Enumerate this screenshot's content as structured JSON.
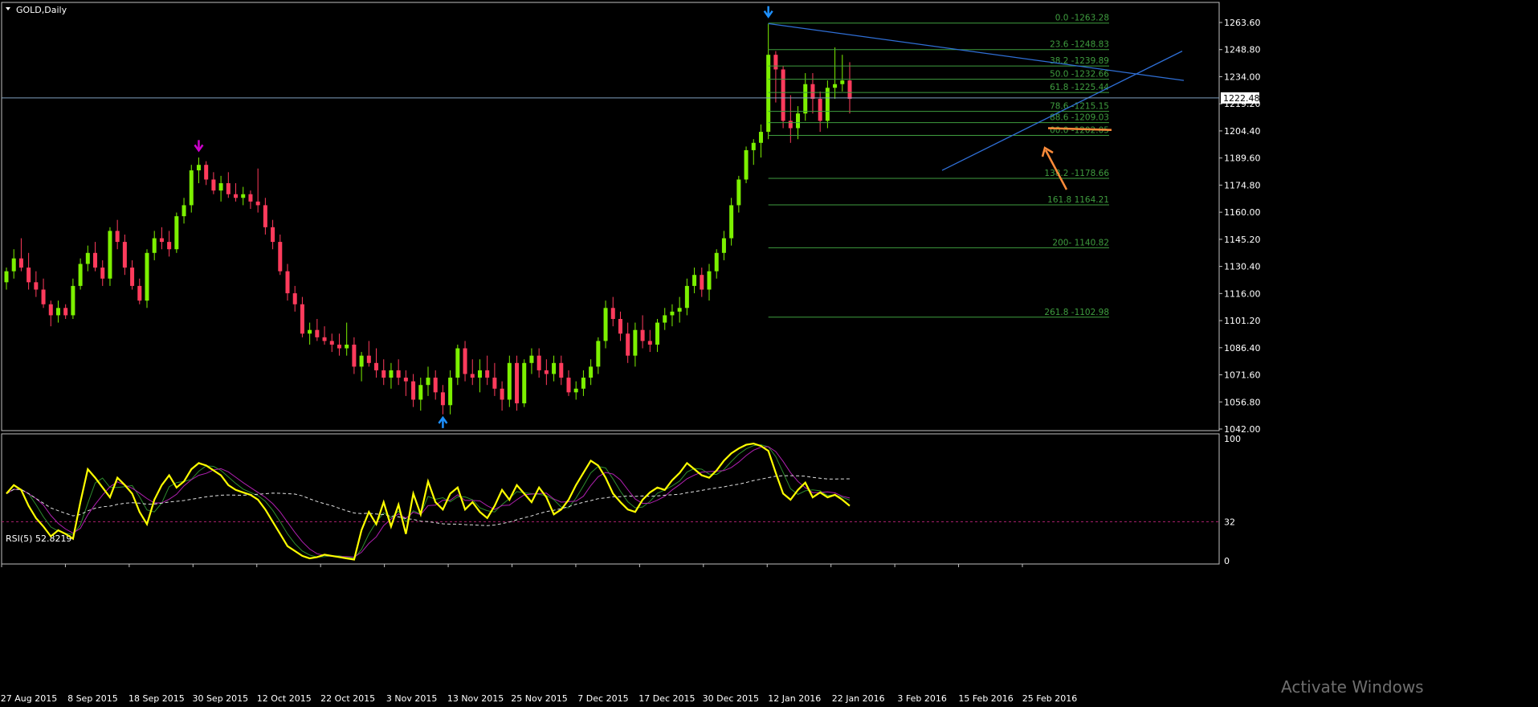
{
  "watermark": "Activate Windows",
  "colors": {
    "background": "#000000",
    "grid_border": "#c0c0c0",
    "candle_up": "#7cf000",
    "candle_down": "#ff3b5c",
    "fibo": "#3f9d3f",
    "fibo_text": "#3f9d3f",
    "trendline": "#2f6fd6",
    "price_line": "#7fa0c0",
    "arrow_orange": "#ff8c3a",
    "rsi_main": "#ffff00",
    "rsi_ma1": "#2e8b2e",
    "rsi_ma2": "#b020b0",
    "rsi_trend": "#e0e0e0",
    "rsi_level": "#b02070",
    "fractal_up": "#1e90ff",
    "fractal_down": "#cc00cc"
  },
  "chart_data": [
    {
      "type": "candlestick",
      "title": "GOLD,Daily",
      "ylim": [
        1042.0,
        1270.0
      ],
      "y_ticks": [
        "1263.60",
        "1248.80",
        "1234.00",
        "1219.20",
        "1204.40",
        "1189.60",
        "1174.80",
        "1160.00",
        "1145.20",
        "1130.40",
        "1116.00",
        "1101.20",
        "1086.40",
        "1071.60",
        "1056.80",
        "1042.00"
      ],
      "current_price": "1222.48",
      "x_tick_labels": [
        "27 Aug 2015",
        "8 Sep 2015",
        "18 Sep 2015",
        "30 Sep 2015",
        "12 Oct 2015",
        "22 Oct 2015",
        "3 Nov 2015",
        "13 Nov 2015",
        "25 Nov 2015",
        "7 Dec 2015",
        "17 Dec 2015",
        "30 Dec 2015",
        "12 Jan 2016",
        "22 Jan 2016",
        "3 Feb 2016",
        "15 Feb 2016",
        "25 Feb 2016"
      ],
      "ohlc": [
        [
          1122,
          1130,
          1118,
          1128
        ],
        [
          1128,
          1140,
          1124,
          1135
        ],
        [
          1135,
          1146,
          1128,
          1130
        ],
        [
          1130,
          1138,
          1118,
          1122
        ],
        [
          1122,
          1128,
          1114,
          1118
        ],
        [
          1118,
          1124,
          1108,
          1110
        ],
        [
          1110,
          1112,
          1098,
          1104
        ],
        [
          1104,
          1112,
          1100,
          1108
        ],
        [
          1108,
          1110,
          1102,
          1104
        ],
        [
          1104,
          1124,
          1102,
          1120
        ],
        [
          1120,
          1135,
          1118,
          1132
        ],
        [
          1132,
          1142,
          1128,
          1138
        ],
        [
          1138,
          1144,
          1128,
          1130
        ],
        [
          1130,
          1134,
          1120,
          1124
        ],
        [
          1124,
          1152,
          1120,
          1150
        ],
        [
          1150,
          1156,
          1140,
          1144
        ],
        [
          1144,
          1148,
          1126,
          1130
        ],
        [
          1130,
          1134,
          1118,
          1120
        ],
        [
          1120,
          1124,
          1110,
          1112
        ],
        [
          1112,
          1140,
          1108,
          1138
        ],
        [
          1138,
          1150,
          1134,
          1146
        ],
        [
          1146,
          1152,
          1140,
          1144
        ],
        [
          1144,
          1150,
          1136,
          1140
        ],
        [
          1140,
          1160,
          1138,
          1158
        ],
        [
          1158,
          1168,
          1154,
          1164
        ],
        [
          1164,
          1186,
          1160,
          1183
        ],
        [
          1183,
          1190,
          1176,
          1186
        ],
        [
          1186,
          1188,
          1175,
          1178
        ],
        [
          1178,
          1182,
          1170,
          1172
        ],
        [
          1172,
          1180,
          1166,
          1176
        ],
        [
          1176,
          1182,
          1168,
          1170
        ],
        [
          1170,
          1176,
          1166,
          1168
        ],
        [
          1168,
          1174,
          1164,
          1170
        ],
        [
          1170,
          1172,
          1162,
          1166
        ],
        [
          1166,
          1184,
          1160,
          1164
        ],
        [
          1164,
          1168,
          1148,
          1152
        ],
        [
          1152,
          1156,
          1140,
          1144
        ],
        [
          1144,
          1148,
          1126,
          1128
        ],
        [
          1128,
          1132,
          1112,
          1116
        ],
        [
          1116,
          1120,
          1106,
          1110
        ],
        [
          1110,
          1114,
          1092,
          1094
        ],
        [
          1094,
          1100,
          1088,
          1096
        ],
        [
          1096,
          1102,
          1090,
          1092
        ],
        [
          1092,
          1098,
          1088,
          1090
        ],
        [
          1090,
          1094,
          1084,
          1088
        ],
        [
          1088,
          1094,
          1082,
          1086
        ],
        [
          1086,
          1100,
          1082,
          1088
        ],
        [
          1088,
          1092,
          1072,
          1076
        ],
        [
          1076,
          1084,
          1068,
          1082
        ],
        [
          1082,
          1090,
          1076,
          1078
        ],
        [
          1078,
          1086,
          1070,
          1074
        ],
        [
          1074,
          1080,
          1066,
          1070
        ],
        [
          1070,
          1078,
          1064,
          1074
        ],
        [
          1074,
          1080,
          1066,
          1070
        ],
        [
          1070,
          1074,
          1060,
          1068
        ],
        [
          1068,
          1072,
          1054,
          1058
        ],
        [
          1058,
          1070,
          1052,
          1066
        ],
        [
          1066,
          1076,
          1060,
          1070
        ],
        [
          1070,
          1074,
          1058,
          1062
        ],
        [
          1062,
          1066,
          1050,
          1055
        ],
        [
          1055,
          1074,
          1050,
          1070
        ],
        [
          1070,
          1088,
          1066,
          1086
        ],
        [
          1086,
          1090,
          1068,
          1072
        ],
        [
          1072,
          1080,
          1066,
          1070
        ],
        [
          1070,
          1080,
          1062,
          1074
        ],
        [
          1074,
          1082,
          1066,
          1070
        ],
        [
          1070,
          1078,
          1060,
          1064
        ],
        [
          1064,
          1068,
          1052,
          1058
        ],
        [
          1058,
          1082,
          1054,
          1078
        ],
        [
          1078,
          1082,
          1052,
          1056
        ],
        [
          1056,
          1080,
          1054,
          1078
        ],
        [
          1078,
          1086,
          1072,
          1082
        ],
        [
          1082,
          1086,
          1070,
          1074
        ],
        [
          1074,
          1080,
          1066,
          1072
        ],
        [
          1072,
          1082,
          1068,
          1078
        ],
        [
          1078,
          1082,
          1066,
          1070
        ],
        [
          1070,
          1074,
          1060,
          1062
        ],
        [
          1062,
          1068,
          1058,
          1064
        ],
        [
          1064,
          1074,
          1060,
          1070
        ],
        [
          1070,
          1080,
          1066,
          1076
        ],
        [
          1076,
          1092,
          1072,
          1090
        ],
        [
          1090,
          1112,
          1086,
          1108
        ],
        [
          1108,
          1114,
          1098,
          1102
        ],
        [
          1102,
          1106,
          1090,
          1094
        ],
        [
          1094,
          1100,
          1078,
          1082
        ],
        [
          1082,
          1100,
          1076,
          1096
        ],
        [
          1096,
          1104,
          1086,
          1090
        ],
        [
          1090,
          1096,
          1084,
          1088
        ],
        [
          1088,
          1102,
          1084,
          1100
        ],
        [
          1100,
          1108,
          1096,
          1104
        ],
        [
          1104,
          1110,
          1098,
          1106
        ],
        [
          1106,
          1114,
          1100,
          1108
        ],
        [
          1108,
          1124,
          1104,
          1120
        ],
        [
          1120,
          1130,
          1116,
          1126
        ],
        [
          1126,
          1130,
          1114,
          1118
        ],
        [
          1118,
          1132,
          1112,
          1128
        ],
        [
          1128,
          1140,
          1124,
          1138
        ],
        [
          1138,
          1150,
          1134,
          1146
        ],
        [
          1146,
          1168,
          1142,
          1164
        ],
        [
          1164,
          1180,
          1160,
          1178
        ],
        [
          1178,
          1196,
          1176,
          1194
        ],
        [
          1194,
          1200,
          1186,
          1198
        ],
        [
          1198,
          1208,
          1190,
          1204
        ],
        [
          1204,
          1263,
          1200,
          1246
        ],
        [
          1246,
          1248,
          1220,
          1238
        ],
        [
          1238,
          1240,
          1206,
          1210
        ],
        [
          1210,
          1224,
          1198,
          1206
        ],
        [
          1206,
          1218,
          1200,
          1214
        ],
        [
          1214,
          1236,
          1210,
          1230
        ],
        [
          1230,
          1236,
          1214,
          1222
        ],
        [
          1222,
          1226,
          1204,
          1210
        ],
        [
          1210,
          1232,
          1206,
          1228
        ],
        [
          1228,
          1250,
          1222,
          1230
        ],
        [
          1230,
          1246,
          1226,
          1232
        ],
        [
          1232,
          1242,
          1214,
          1222
        ]
      ],
      "fibo_levels": [
        {
          "label": "0.0 -1263.28",
          "value": 1263.28
        },
        {
          "label": "23.6 -1248.83",
          "value": 1248.83
        },
        {
          "label": "38.2 -1239.89",
          "value": 1239.89
        },
        {
          "label": "50.0 -1232.66",
          "value": 1232.66
        },
        {
          "label": "61.8 -1225.44",
          "value": 1225.44
        },
        {
          "label": "78.6 -1215.15",
          "value": 1215.15
        },
        {
          "label": "88.6 -1209.03",
          "value": 1209.03
        },
        {
          "label": "00.0 -1202.05",
          "value": 1202.05
        },
        {
          "label": "138.2 -1178.66",
          "value": 1178.66
        },
        {
          "label": "161.8 1164.21",
          "value": 1164.21
        },
        {
          "label": "200- 1140.82",
          "value": 1140.82
        },
        {
          "label": "261.8 -1102.98",
          "value": 1102.98
        }
      ]
    },
    {
      "type": "line",
      "title": "RSI(5) 52.8219",
      "ylim": [
        0,
        100
      ],
      "y_ticks": [
        "100",
        "32",
        "0"
      ],
      "level": 32,
      "series": [
        {
          "values": [
            55,
            62,
            58,
            45,
            35,
            28,
            20,
            25,
            22,
            18,
            48,
            75,
            68,
            60,
            52,
            68,
            62,
            55,
            40,
            30,
            50,
            62,
            70,
            60,
            65,
            75,
            80,
            78,
            74,
            70,
            62,
            58,
            56,
            54,
            50,
            42,
            32,
            22,
            12,
            8,
            4,
            2,
            3,
            5,
            4,
            3,
            2,
            1,
            25,
            40,
            30,
            48,
            28,
            46,
            22,
            55,
            38,
            65,
            48,
            42,
            55,
            60,
            42,
            48,
            40,
            35,
            45,
            58,
            50,
            62,
            55,
            48,
            60,
            52,
            38,
            42,
            50,
            62,
            72,
            82,
            78,
            68,
            55,
            48,
            42,
            40,
            50,
            56,
            60,
            58,
            66,
            72,
            80,
            75,
            70,
            68,
            74,
            82,
            88,
            92,
            95,
            96,
            94,
            90,
            72,
            55,
            50,
            58,
            64,
            52,
            56,
            52,
            54,
            50,
            45
          ]
        }
      ]
    }
  ]
}
